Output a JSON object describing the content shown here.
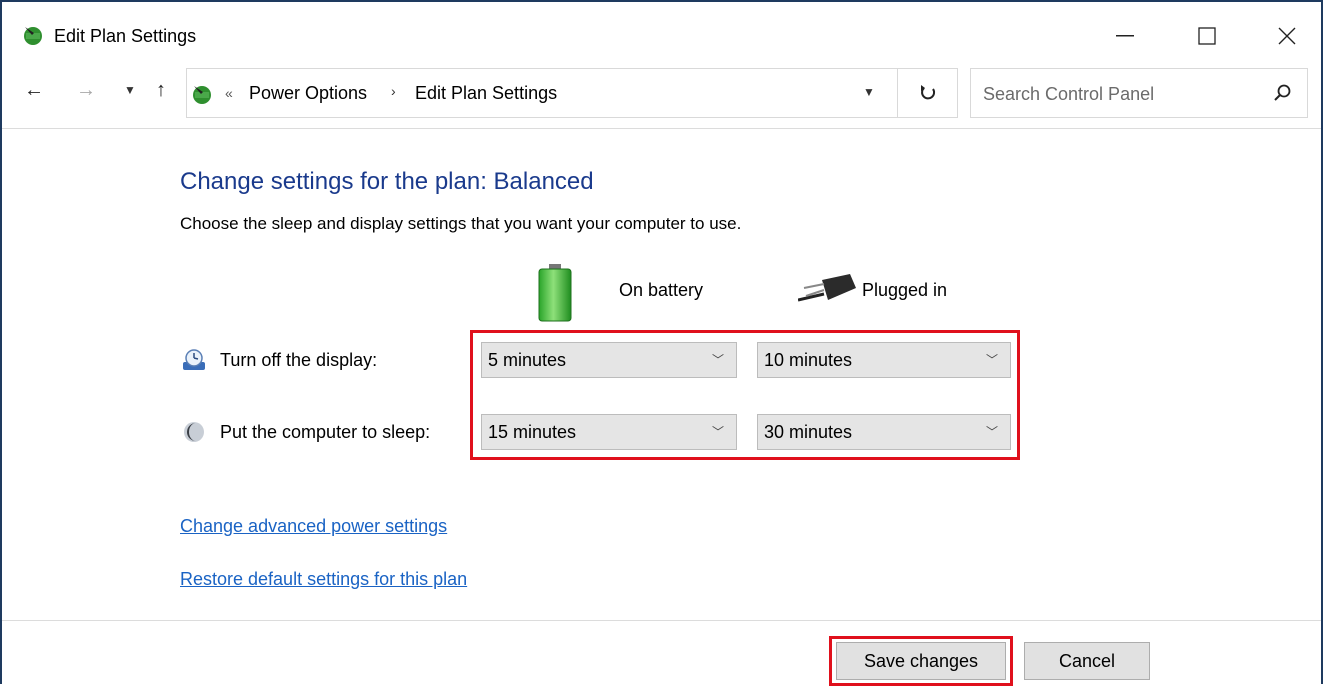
{
  "window": {
    "title": "Edit Plan Settings"
  },
  "address": {
    "breadcrumbs": [
      "Power Options",
      "Edit Plan Settings"
    ],
    "overflow": "«",
    "separator": "›"
  },
  "search": {
    "placeholder": "Search Control Panel"
  },
  "content": {
    "heading": "Change settings for the plan: Balanced",
    "subtitle": "Choose the sleep and display settings that you want your computer to use.",
    "columns": {
      "battery": "On battery",
      "plugged": "Plugged in"
    },
    "rows": [
      {
        "label": "Turn off the display:",
        "battery": "5 minutes",
        "plugged": "10 minutes"
      },
      {
        "label": "Put the computer to sleep:",
        "battery": "15 minutes",
        "plugged": "30 minutes"
      }
    ],
    "links": {
      "advanced": "Change advanced power settings",
      "restore": "Restore default settings for this plan"
    }
  },
  "buttons": {
    "save": "Save changes",
    "cancel": "Cancel"
  },
  "colors": {
    "heading": "#1a3a8c",
    "link": "#1a63c4",
    "highlight": "#e0101c"
  },
  "icons": {
    "app": "power-options-icon",
    "battery": "battery-icon",
    "plug": "power-plug-icon",
    "display": "display-clock-icon",
    "sleep": "sleep-moon-icon"
  }
}
